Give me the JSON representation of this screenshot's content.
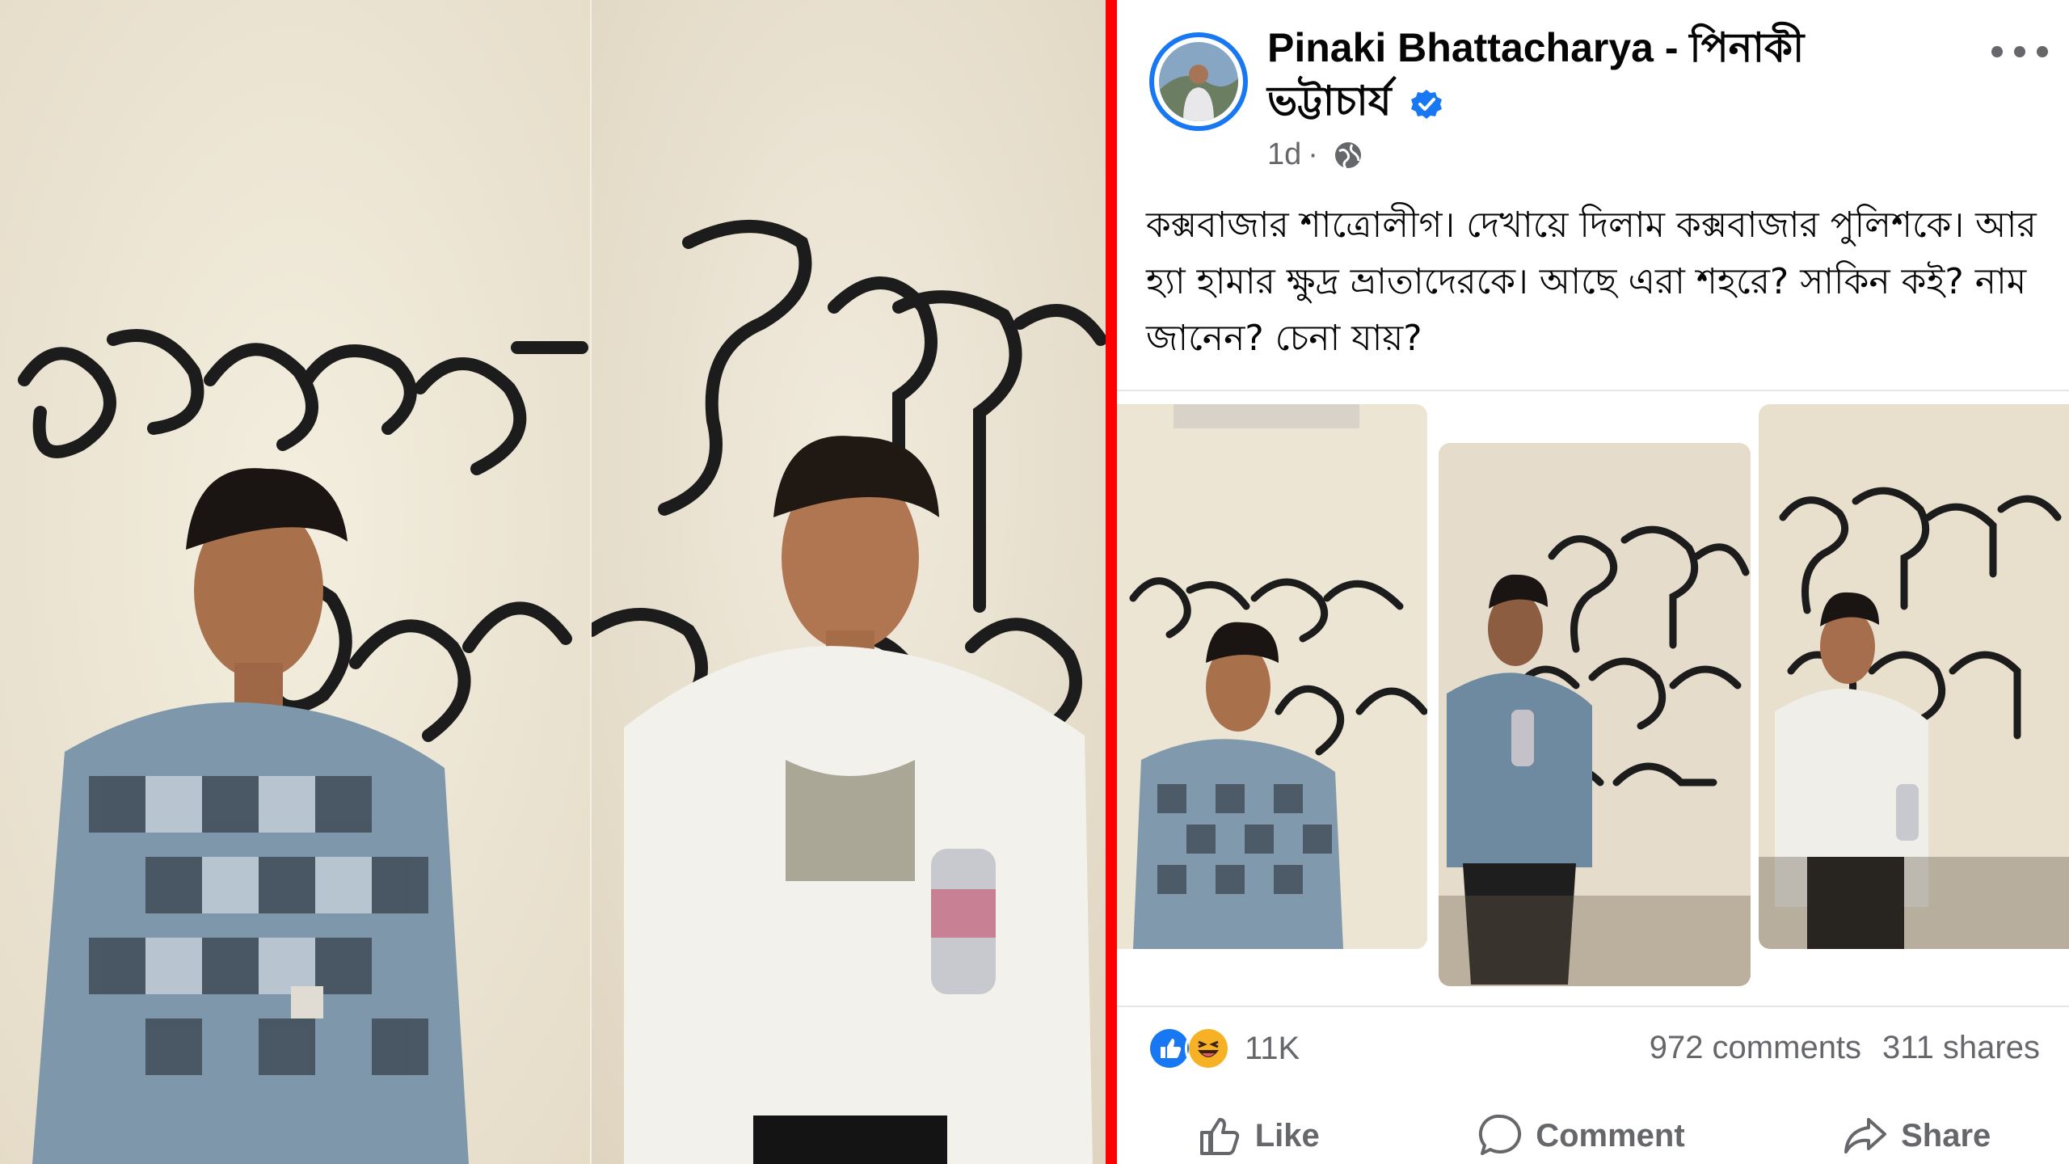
{
  "post": {
    "author_line1": "Pinaki Bhattacharya - পিনাকী",
    "author_line2": "ভট্টাচার্য",
    "verified_icon": "verified-badge-icon",
    "time": "1d",
    "separator": "·",
    "audience_icon": "globe-icon",
    "text": "কক্সবাজার শাত্রোলীগ। দেখায়ে দিলাম কক্সবাজার পুলিশকে। আর হ্যা হামার ক্ষুদ্র ভ্রাতাদেরকে। আছে এরা শহরে? সাকিন কই? নাম জানেন? চেনা যায়?",
    "images_count": 3
  },
  "stats": {
    "reaction_icons": [
      "like-icon",
      "haha-icon"
    ],
    "reactions": "11K",
    "comments": "972 comments",
    "shares": "311 shares"
  },
  "actions": {
    "like": "Like",
    "comment": "Comment",
    "share": "Share"
  },
  "colors": {
    "accent": "#1877f2",
    "divider": "#ff0000",
    "muted": "#65676b",
    "text": "#050505"
  }
}
